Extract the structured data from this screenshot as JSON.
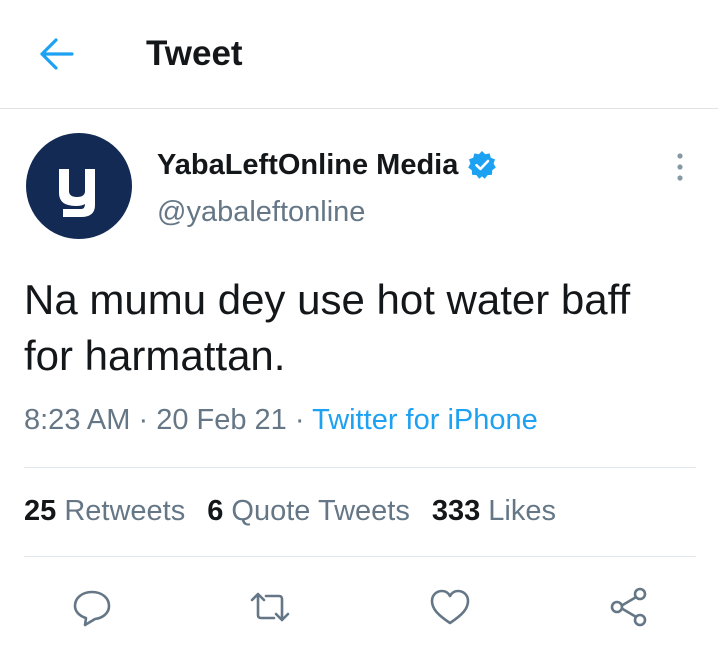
{
  "header": {
    "title": "Tweet",
    "back_icon": "arrow-left-icon"
  },
  "tweet": {
    "author_name": "YabaLeftOnline Media",
    "handle": "@yabaleftonline",
    "verified": true,
    "text": "Na mumu dey use hot water baff for harmattan.",
    "time": "8:23 AM",
    "date": "20 Feb 21",
    "separator": "·",
    "source": "Twitter for iPhone",
    "avatar_letter": "y"
  },
  "stats": {
    "retweets_count": "25",
    "retweets_label": "Retweets",
    "quotes_count": "6",
    "quotes_label": "Quote Tweets",
    "likes_count": "333",
    "likes_label": "Likes"
  },
  "actions": [
    "reply-icon",
    "retweet-icon",
    "like-icon",
    "share-icon"
  ],
  "colors": {
    "accent": "#1da1f2",
    "text": "#14171a",
    "secondary": "#657786",
    "avatar_bg": "#132a54",
    "divider": "#e1e8ed"
  }
}
